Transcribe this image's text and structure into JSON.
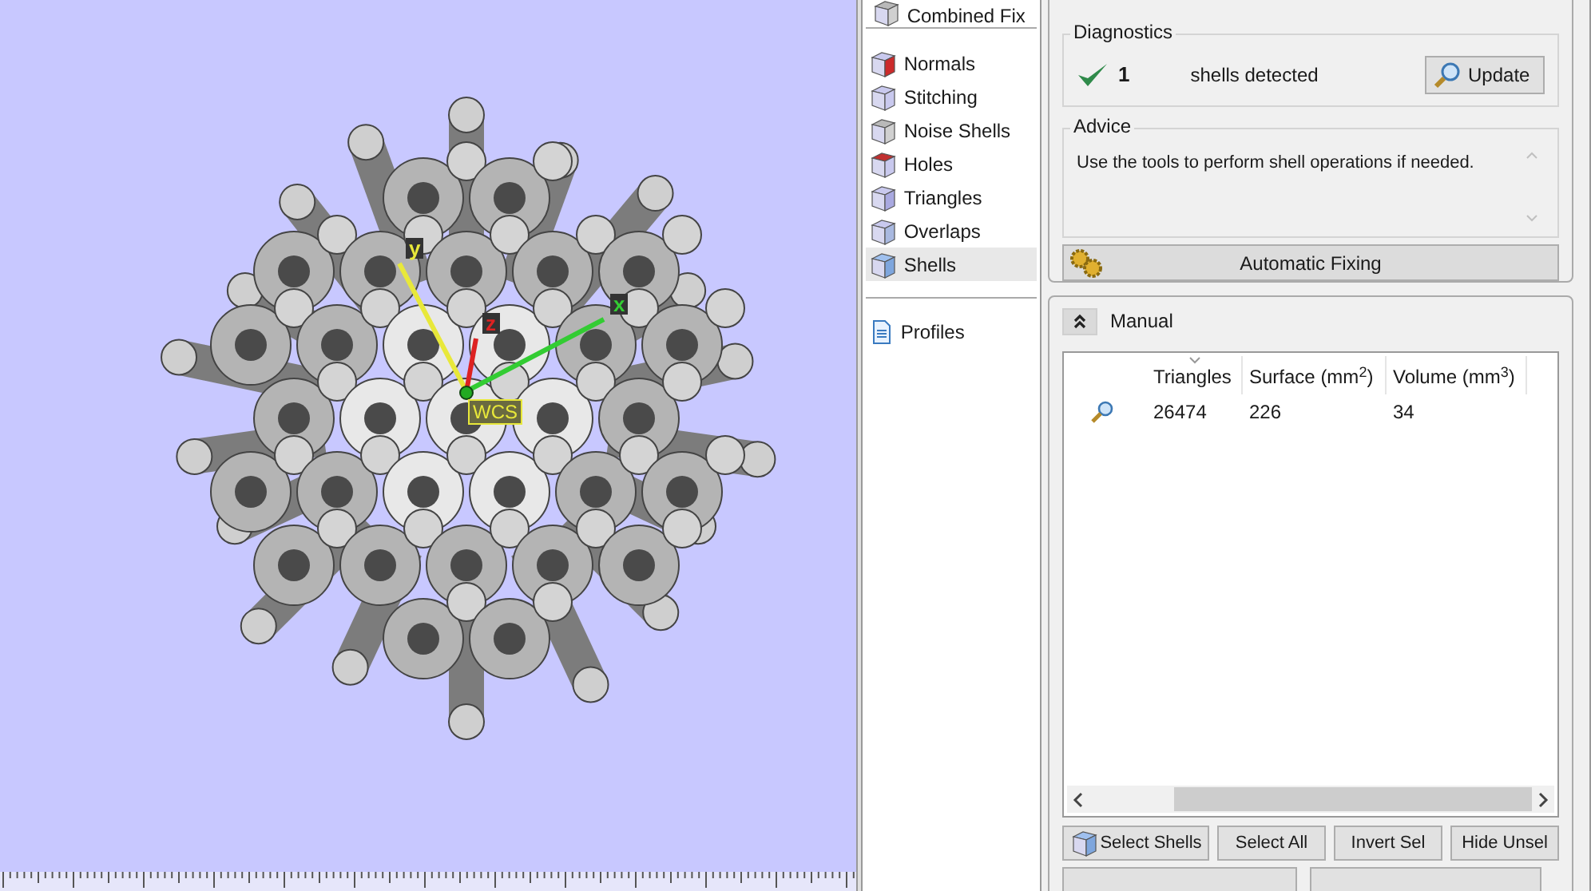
{
  "viewport": {
    "axes": [
      {
        "label": "y",
        "color": "#e8e83a"
      },
      {
        "label": "x",
        "color": "#33cc33"
      },
      {
        "label": "z",
        "color": "#dd2222"
      }
    ],
    "wcs_label": "WCS"
  },
  "sidebar": {
    "top_item": "Combined Fix",
    "items": [
      {
        "label": "Normals",
        "selected": false
      },
      {
        "label": "Stitching",
        "selected": false
      },
      {
        "label": "Noise Shells",
        "selected": false
      },
      {
        "label": "Holes",
        "selected": false
      },
      {
        "label": "Triangles",
        "selected": false
      },
      {
        "label": "Overlaps",
        "selected": false
      },
      {
        "label": "Shells",
        "selected": true
      }
    ],
    "bottom_items": [
      {
        "label": "Profiles"
      }
    ]
  },
  "diagnostics": {
    "title": "Diagnostics",
    "ok": true,
    "count": "1",
    "message": "shells detected",
    "button": "Update"
  },
  "advice": {
    "title": "Advice",
    "text": "Use the tools to perform shell operations if needed."
  },
  "auto_fix_button": "Automatic Fixing",
  "manual": {
    "title": "Manual",
    "expanded": true,
    "columns": [
      {
        "label": "Triangles",
        "sorted": true
      },
      {
        "label": "Surface (mm$^{2}$)",
        "sorted": false
      },
      {
        "label": "Volume (mm$^{3}$)",
        "sorted": false
      }
    ],
    "rows": [
      {
        "cells": [
          "26474",
          "226",
          "34"
        ]
      }
    ],
    "buttons": [
      "Select Shells",
      "Select All",
      "Invert Sel",
      "Hide Unsel"
    ]
  }
}
